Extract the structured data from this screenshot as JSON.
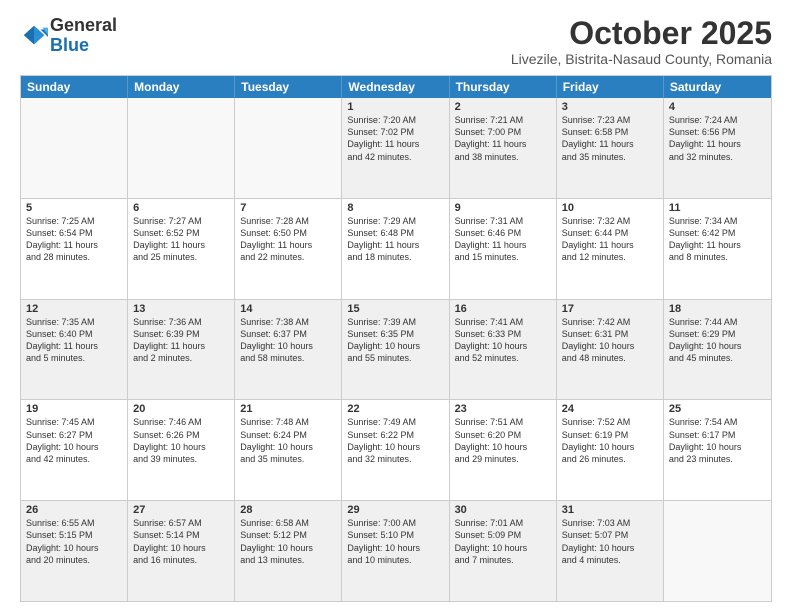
{
  "logo": {
    "general": "General",
    "blue": "Blue"
  },
  "header": {
    "month": "October 2025",
    "location": "Livezile, Bistrita-Nasaud County, Romania"
  },
  "weekdays": [
    "Sunday",
    "Monday",
    "Tuesday",
    "Wednesday",
    "Thursday",
    "Friday",
    "Saturday"
  ],
  "rows": [
    [
      {
        "day": "",
        "text": ""
      },
      {
        "day": "",
        "text": ""
      },
      {
        "day": "",
        "text": ""
      },
      {
        "day": "1",
        "text": "Sunrise: 7:20 AM\nSunset: 7:02 PM\nDaylight: 11 hours\nand 42 minutes."
      },
      {
        "day": "2",
        "text": "Sunrise: 7:21 AM\nSunset: 7:00 PM\nDaylight: 11 hours\nand 38 minutes."
      },
      {
        "day": "3",
        "text": "Sunrise: 7:23 AM\nSunset: 6:58 PM\nDaylight: 11 hours\nand 35 minutes."
      },
      {
        "day": "4",
        "text": "Sunrise: 7:24 AM\nSunset: 6:56 PM\nDaylight: 11 hours\nand 32 minutes."
      }
    ],
    [
      {
        "day": "5",
        "text": "Sunrise: 7:25 AM\nSunset: 6:54 PM\nDaylight: 11 hours\nand 28 minutes."
      },
      {
        "day": "6",
        "text": "Sunrise: 7:27 AM\nSunset: 6:52 PM\nDaylight: 11 hours\nand 25 minutes."
      },
      {
        "day": "7",
        "text": "Sunrise: 7:28 AM\nSunset: 6:50 PM\nDaylight: 11 hours\nand 22 minutes."
      },
      {
        "day": "8",
        "text": "Sunrise: 7:29 AM\nSunset: 6:48 PM\nDaylight: 11 hours\nand 18 minutes."
      },
      {
        "day": "9",
        "text": "Sunrise: 7:31 AM\nSunset: 6:46 PM\nDaylight: 11 hours\nand 15 minutes."
      },
      {
        "day": "10",
        "text": "Sunrise: 7:32 AM\nSunset: 6:44 PM\nDaylight: 11 hours\nand 12 minutes."
      },
      {
        "day": "11",
        "text": "Sunrise: 7:34 AM\nSunset: 6:42 PM\nDaylight: 11 hours\nand 8 minutes."
      }
    ],
    [
      {
        "day": "12",
        "text": "Sunrise: 7:35 AM\nSunset: 6:40 PM\nDaylight: 11 hours\nand 5 minutes."
      },
      {
        "day": "13",
        "text": "Sunrise: 7:36 AM\nSunset: 6:39 PM\nDaylight: 11 hours\nand 2 minutes."
      },
      {
        "day": "14",
        "text": "Sunrise: 7:38 AM\nSunset: 6:37 PM\nDaylight: 10 hours\nand 58 minutes."
      },
      {
        "day": "15",
        "text": "Sunrise: 7:39 AM\nSunset: 6:35 PM\nDaylight: 10 hours\nand 55 minutes."
      },
      {
        "day": "16",
        "text": "Sunrise: 7:41 AM\nSunset: 6:33 PM\nDaylight: 10 hours\nand 52 minutes."
      },
      {
        "day": "17",
        "text": "Sunrise: 7:42 AM\nSunset: 6:31 PM\nDaylight: 10 hours\nand 48 minutes."
      },
      {
        "day": "18",
        "text": "Sunrise: 7:44 AM\nSunset: 6:29 PM\nDaylight: 10 hours\nand 45 minutes."
      }
    ],
    [
      {
        "day": "19",
        "text": "Sunrise: 7:45 AM\nSunset: 6:27 PM\nDaylight: 10 hours\nand 42 minutes."
      },
      {
        "day": "20",
        "text": "Sunrise: 7:46 AM\nSunset: 6:26 PM\nDaylight: 10 hours\nand 39 minutes."
      },
      {
        "day": "21",
        "text": "Sunrise: 7:48 AM\nSunset: 6:24 PM\nDaylight: 10 hours\nand 35 minutes."
      },
      {
        "day": "22",
        "text": "Sunrise: 7:49 AM\nSunset: 6:22 PM\nDaylight: 10 hours\nand 32 minutes."
      },
      {
        "day": "23",
        "text": "Sunrise: 7:51 AM\nSunset: 6:20 PM\nDaylight: 10 hours\nand 29 minutes."
      },
      {
        "day": "24",
        "text": "Sunrise: 7:52 AM\nSunset: 6:19 PM\nDaylight: 10 hours\nand 26 minutes."
      },
      {
        "day": "25",
        "text": "Sunrise: 7:54 AM\nSunset: 6:17 PM\nDaylight: 10 hours\nand 23 minutes."
      }
    ],
    [
      {
        "day": "26",
        "text": "Sunrise: 6:55 AM\nSunset: 5:15 PM\nDaylight: 10 hours\nand 20 minutes."
      },
      {
        "day": "27",
        "text": "Sunrise: 6:57 AM\nSunset: 5:14 PM\nDaylight: 10 hours\nand 16 minutes."
      },
      {
        "day": "28",
        "text": "Sunrise: 6:58 AM\nSunset: 5:12 PM\nDaylight: 10 hours\nand 13 minutes."
      },
      {
        "day": "29",
        "text": "Sunrise: 7:00 AM\nSunset: 5:10 PM\nDaylight: 10 hours\nand 10 minutes."
      },
      {
        "day": "30",
        "text": "Sunrise: 7:01 AM\nSunset: 5:09 PM\nDaylight: 10 hours\nand 7 minutes."
      },
      {
        "day": "31",
        "text": "Sunrise: 7:03 AM\nSunset: 5:07 PM\nDaylight: 10 hours\nand 4 minutes."
      },
      {
        "day": "",
        "text": ""
      }
    ]
  ]
}
